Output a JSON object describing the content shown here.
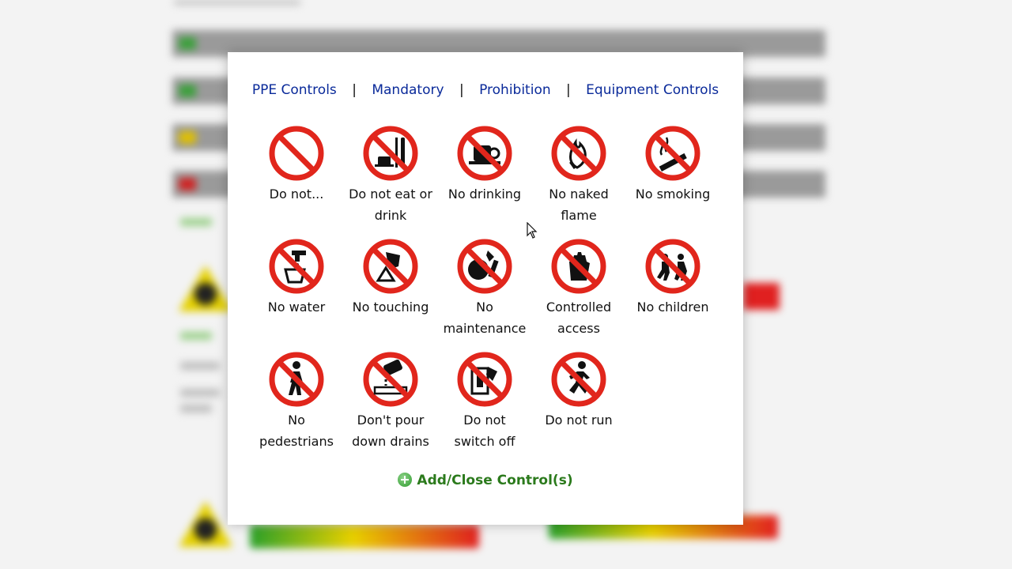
{
  "tabs": [
    {
      "label": "PPE Controls"
    },
    {
      "label": "Mandatory"
    },
    {
      "label": "Prohibition"
    },
    {
      "label": "Equipment Controls"
    }
  ],
  "separator": "|",
  "signs": [
    {
      "line1": "Do not...",
      "line2": "",
      "icon": "no-prohibition-icon"
    },
    {
      "line1": "Do not eat or",
      "line2": "drink",
      "icon": "no-eat-drink-icon"
    },
    {
      "line1": "No drinking",
      "line2": "",
      "icon": "no-drinking-icon"
    },
    {
      "line1": "No naked",
      "line2": "flame",
      "icon": "no-naked-flame-icon"
    },
    {
      "line1": "No smoking",
      "line2": "",
      "icon": "no-smoking-icon"
    },
    {
      "line1": "No water",
      "line2": "",
      "icon": "no-water-icon"
    },
    {
      "line1": "No touching",
      "line2": "",
      "icon": "no-touching-icon"
    },
    {
      "line1": "No",
      "line2": "maintenance",
      "icon": "no-maintenance-icon"
    },
    {
      "line1": "Controlled",
      "line2": "access",
      "icon": "controlled-access-icon"
    },
    {
      "line1": "No children",
      "line2": "",
      "icon": "no-children-icon"
    },
    {
      "line1": "No",
      "line2": "pedestrians",
      "icon": "no-pedestrians-icon"
    },
    {
      "line1": "Don't pour",
      "line2": "down drains",
      "icon": "no-pour-drains-icon"
    },
    {
      "line1": "Do not",
      "line2": "switch off",
      "icon": "do-not-switch-off-icon"
    },
    {
      "line1": "Do not run",
      "line2": "",
      "icon": "do-not-run-icon"
    }
  ],
  "add_close_label": "Add/Close Control(s)",
  "colors": {
    "prohibition_red": "#e1261c",
    "link_blue": "#0a2a9a",
    "action_green": "#2b7a1c"
  }
}
